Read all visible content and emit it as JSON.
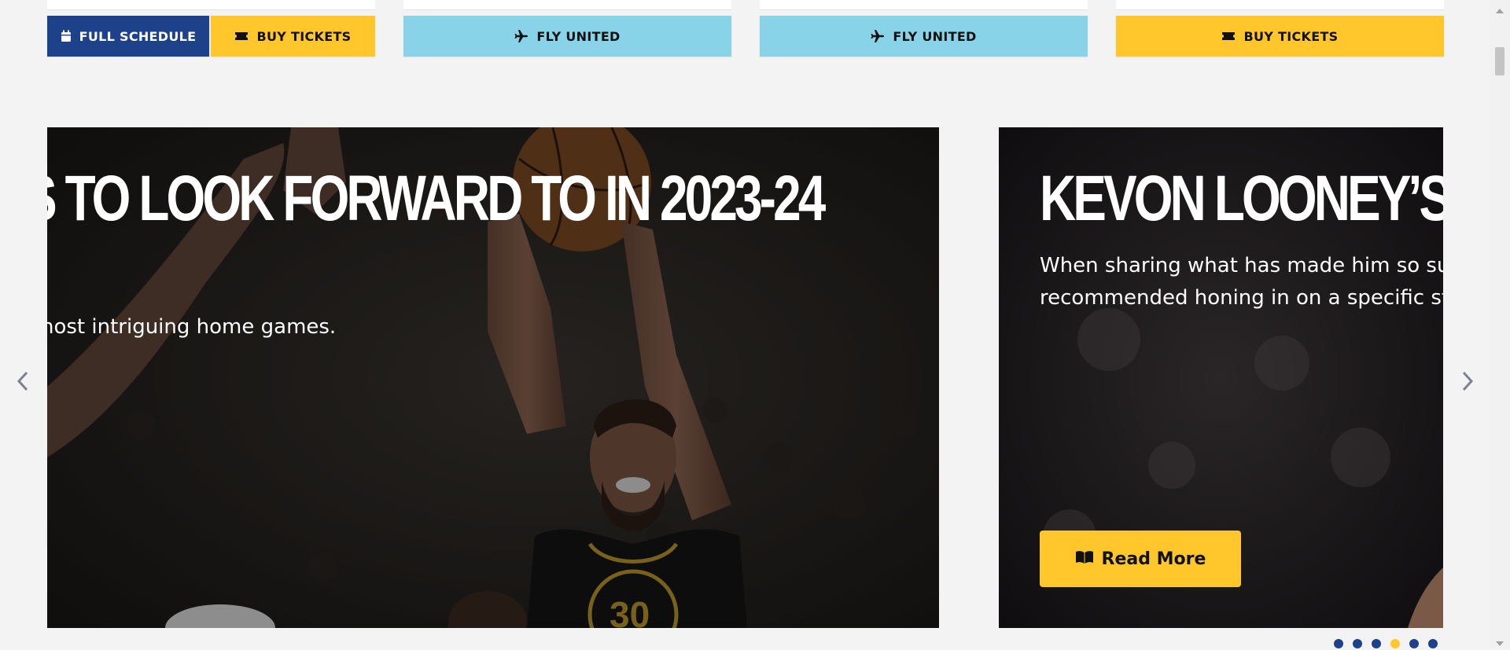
{
  "top_buttons": {
    "full_schedule": "FULL SCHEDULE",
    "buy_tickets_1": "BUY TICKETS",
    "fly_united_1": "FLY UNITED",
    "fly_united_2": "FLY UNITED",
    "buy_tickets_2": "BUY TICKETS"
  },
  "slides": [
    {
      "headline": "S TO LOOK FORWARD TO IN 2023-24",
      "description": "nost intriguing home games."
    },
    {
      "headline": "KEVON LOONEY’S S",
      "description": "When sharing what has made him so suc recommended honing in on a specific str",
      "cta": "Read More"
    }
  ],
  "carousel": {
    "prev_icon": "chevron-left-icon",
    "next_icon": "chevron-right-icon",
    "dots": [
      "dot",
      "dot",
      "dot",
      "dot",
      "dot",
      "dot"
    ],
    "active_dot": 3
  },
  "colors": {
    "navy": "#1d428a",
    "gold": "#ffc72c",
    "sky": "#89d3e8",
    "page_bg": "#f3f3f3"
  }
}
